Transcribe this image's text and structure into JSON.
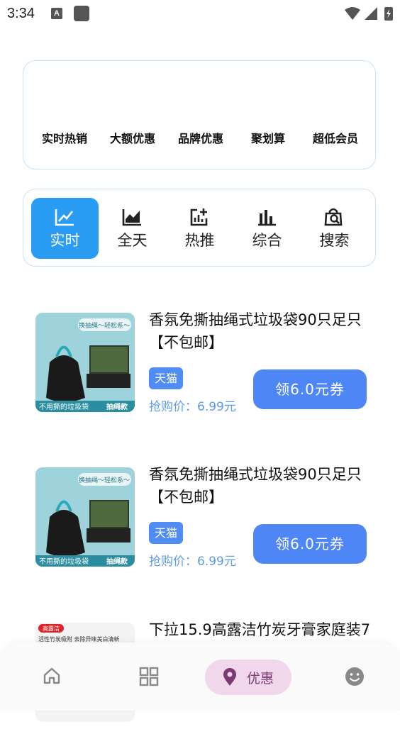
{
  "status": {
    "time": "3:34",
    "a_icon": "A"
  },
  "categories": [
    "实时热销",
    "大额优惠",
    "品牌优惠",
    "聚划算",
    "超低会员"
  ],
  "tabs": [
    {
      "label": "实时",
      "icon": "trending-icon",
      "active": true
    },
    {
      "label": "全天",
      "icon": "area-chart-icon",
      "active": false
    },
    {
      "label": "热推",
      "icon": "bar-chart-plus-icon",
      "active": false
    },
    {
      "label": "综合",
      "icon": "bar-chart-icon",
      "active": false
    },
    {
      "label": "搜索",
      "icon": "search-bag-icon",
      "active": false
    }
  ],
  "products": [
    {
      "title": "香氛免撕抽绳式垃圾袋90只足只【不包邮】",
      "badge": "天猫",
      "price": "抢购价：6.99元",
      "button": "领6.0元券",
      "img_top": "换抽绳～轻松系～",
      "img_bottom_left": "不用撕的垃圾袋",
      "img_bottom_right": "抽绳款"
    },
    {
      "title": "香氛免撕抽绳式垃圾袋90只足只【不包邮】",
      "badge": "天猫",
      "price": "抢购价：6.99元",
      "button": "领6.0元券",
      "img_top": "换抽绳～轻松系～",
      "img_bottom_left": "不用撕的垃圾袋",
      "img_bottom_right": "抽绳款"
    },
    {
      "title": "下拉15.9高露洁竹炭牙膏家庭装7",
      "img_top": "高露洁",
      "img_sub": "活性竹炭吸附 去除异味美白清新"
    }
  ],
  "nav": [
    {
      "name": "home-icon"
    },
    {
      "name": "grid-icon"
    },
    {
      "name": "discount-pin-icon",
      "label": "优惠",
      "active": true
    },
    {
      "name": "smiley-icon"
    }
  ]
}
